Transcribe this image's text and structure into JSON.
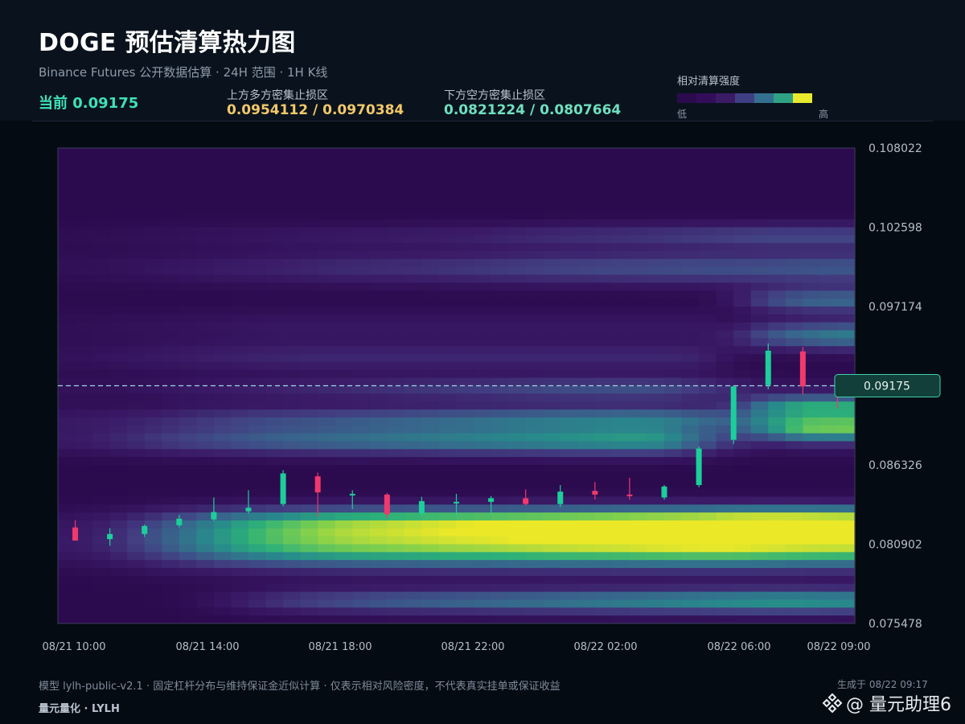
{
  "header": {
    "title": "DOGE 预估清算热力图",
    "subtitle": "Binance Futures 公开数据估算 · 24H 范围 · 1H K线",
    "current": "当前 0.09175",
    "upper_label": "上方多方密集止损区",
    "upper_value": "0.0954112 / 0.0970384",
    "lower_label": "下方空方密集止损区",
    "lower_value": "0.0821224 / 0.0807664"
  },
  "legend": {
    "title": "相对清算强度",
    "low": "低",
    "high": "高",
    "colors": [
      "#2c0a4e",
      "#330d5a",
      "#3b1a66",
      "#3e3f82",
      "#346f90",
      "#2ea383",
      "#e9e92d"
    ]
  },
  "colors": {
    "background": "#050b12",
    "header_bg": "#0a131d",
    "accent": "#3fe0b8",
    "upper_zone": "#f2c86a",
    "lower_zone": "#6fe0c0",
    "candle_up": "#1ccf9a",
    "candle_down": "#f0396d",
    "current_line": "#9fd6e3"
  },
  "chart_data": {
    "type": "heatmap",
    "overlay": "candlestick",
    "y_ticks": [
      "0.108022",
      "0.102598",
      "0.097174",
      "0.091750",
      "0.086326",
      "0.080902",
      "0.075478"
    ],
    "ylim": [
      0.075478,
      0.108022
    ],
    "x_ticks": [
      "08/21 10:00",
      "08/21 14:00",
      "08/21 18:00",
      "08/21 22:00",
      "08/22 02:00",
      "08/22 06:00",
      "08/22 09:00"
    ],
    "current_price": 0.09175,
    "current_price_label": "0.09175",
    "candles": [
      {
        "o": 0.08205,
        "h": 0.08255,
        "l": 0.08115,
        "c": 0.08115
      },
      {
        "o": 0.08125,
        "h": 0.082,
        "l": 0.0808,
        "c": 0.0816
      },
      {
        "o": 0.0816,
        "h": 0.08225,
        "l": 0.0814,
        "c": 0.08215
      },
      {
        "o": 0.0822,
        "h": 0.0829,
        "l": 0.08205,
        "c": 0.08265
      },
      {
        "o": 0.0826,
        "h": 0.0841,
        "l": 0.0825,
        "c": 0.0831
      },
      {
        "o": 0.08315,
        "h": 0.0846,
        "l": 0.083,
        "c": 0.0834
      },
      {
        "o": 0.08365,
        "h": 0.08597,
        "l": 0.0835,
        "c": 0.08575
      },
      {
        "o": 0.08555,
        "h": 0.0858,
        "l": 0.0828,
        "c": 0.08445
      },
      {
        "o": 0.0843,
        "h": 0.0846,
        "l": 0.0833,
        "c": 0.08435
      },
      {
        "o": 0.0843,
        "h": 0.0844,
        "l": 0.0827,
        "c": 0.08295
      },
      {
        "o": 0.083,
        "h": 0.08415,
        "l": 0.0828,
        "c": 0.08385
      },
      {
        "o": 0.0838,
        "h": 0.08435,
        "l": 0.08285,
        "c": 0.0838
      },
      {
        "o": 0.0838,
        "h": 0.0842,
        "l": 0.083,
        "c": 0.08405
      },
      {
        "o": 0.08405,
        "h": 0.08465,
        "l": 0.08355,
        "c": 0.08365
      },
      {
        "o": 0.08365,
        "h": 0.08495,
        "l": 0.08345,
        "c": 0.0845
      },
      {
        "o": 0.08455,
        "h": 0.08515,
        "l": 0.08395,
        "c": 0.0843
      },
      {
        "o": 0.0843,
        "h": 0.08545,
        "l": 0.08395,
        "c": 0.0842
      },
      {
        "o": 0.0841,
        "h": 0.08495,
        "l": 0.08395,
        "c": 0.08485
      },
      {
        "o": 0.08495,
        "h": 0.0876,
        "l": 0.0848,
        "c": 0.08745
      },
      {
        "o": 0.08805,
        "h": 0.09175,
        "l": 0.08775,
        "c": 0.0917
      },
      {
        "o": 0.0918,
        "h": 0.09465,
        "l": 0.0915,
        "c": 0.09415
      },
      {
        "o": 0.0941,
        "h": 0.0944,
        "l": 0.09115,
        "c": 0.0917
      },
      {
        "o": 0.09175,
        "h": 0.09195,
        "l": 0.0902,
        "c": 0.0916
      }
    ],
    "heat_bands": [
      {
        "center": 0.0809,
        "sigma": 0.0011,
        "intensity": [
          0.12,
          0.18,
          0.3,
          0.42,
          0.55,
          0.66,
          0.74,
          0.8,
          0.84,
          0.86,
          0.88,
          0.9,
          0.91,
          0.93,
          0.95,
          0.96,
          0.97,
          0.99,
          1.0,
          1.0,
          0.98,
          0.96,
          0.95
        ]
      },
      {
        "center": 0.0825,
        "sigma": 0.0007,
        "intensity": [
          0.05,
          0.08,
          0.14,
          0.22,
          0.3,
          0.38,
          0.44,
          0.5,
          0.54,
          0.56,
          0.58,
          0.6,
          0.62,
          0.64,
          0.66,
          0.68,
          0.7,
          0.72,
          0.74,
          0.78,
          0.8,
          0.8,
          0.78
        ]
      },
      {
        "center": 0.077,
        "sigma": 0.0006,
        "intensity": [
          0.0,
          0.0,
          0.0,
          0.02,
          0.08,
          0.16,
          0.24,
          0.3,
          0.34,
          0.38,
          0.4,
          0.42,
          0.44,
          0.46,
          0.48,
          0.5,
          0.52,
          0.54,
          0.56,
          0.58,
          0.6,
          0.6,
          0.58
        ]
      },
      {
        "center": 0.088,
        "sigma": 0.0007,
        "intensity": [
          0.12,
          0.16,
          0.22,
          0.28,
          0.32,
          0.36,
          0.4,
          0.42,
          0.44,
          0.46,
          0.48,
          0.5,
          0.52,
          0.54,
          0.56,
          0.58,
          0.6,
          0.58,
          0.4,
          0.2,
          0.1,
          0.1,
          0.1
        ]
      },
      {
        "center": 0.0895,
        "sigma": 0.0006,
        "intensity": [
          0.1,
          0.12,
          0.14,
          0.18,
          0.22,
          0.26,
          0.28,
          0.3,
          0.32,
          0.34,
          0.36,
          0.38,
          0.4,
          0.42,
          0.44,
          0.45,
          0.46,
          0.45,
          0.4,
          0.3,
          0.3,
          0.3,
          0.3
        ]
      },
      {
        "center": 0.0915,
        "sigma": 0.0006,
        "intensity": [
          0.06,
          0.06,
          0.08,
          0.1,
          0.12,
          0.14,
          0.16,
          0.18,
          0.2,
          0.22,
          0.24,
          0.26,
          0.28,
          0.3,
          0.32,
          0.33,
          0.34,
          0.32,
          0.26,
          0.18,
          0.1,
          0.08,
          0.08
        ]
      },
      {
        "center": 0.0888,
        "sigma": 0.0006,
        "intensity": [
          0.0,
          0.0,
          0.0,
          0.0,
          0.0,
          0.0,
          0.0,
          0.0,
          0.0,
          0.0,
          0.0,
          0.0,
          0.0,
          0.0,
          0.0,
          0.0,
          0.0,
          0.0,
          0.0,
          0.1,
          0.35,
          0.6,
          0.62
        ]
      },
      {
        "center": 0.0904,
        "sigma": 0.0005,
        "intensity": [
          0.0,
          0.0,
          0.0,
          0.0,
          0.0,
          0.0,
          0.0,
          0.0,
          0.0,
          0.0,
          0.0,
          0.0,
          0.0,
          0.0,
          0.0,
          0.0,
          0.0,
          0.0,
          0.0,
          0.1,
          0.4,
          0.55,
          0.55
        ]
      },
      {
        "center": 0.0952,
        "sigma": 0.0007,
        "intensity": [
          0.0,
          0.0,
          0.0,
          0.0,
          0.0,
          0.0,
          0.0,
          0.0,
          0.0,
          0.0,
          0.0,
          0.0,
          0.0,
          0.0,
          0.0,
          0.0,
          0.0,
          0.0,
          0.0,
          0.15,
          0.35,
          0.45,
          0.5
        ]
      },
      {
        "center": 0.0976,
        "sigma": 0.0006,
        "intensity": [
          0.0,
          0.0,
          0.0,
          0.0,
          0.0,
          0.0,
          0.0,
          0.0,
          0.0,
          0.0,
          0.0,
          0.0,
          0.0,
          0.0,
          0.0,
          0.0,
          0.0,
          0.0,
          0.0,
          0.1,
          0.3,
          0.4,
          0.42
        ]
      },
      {
        "center": 0.0998,
        "sigma": 0.0008,
        "intensity": [
          0.05,
          0.06,
          0.08,
          0.1,
          0.12,
          0.14,
          0.16,
          0.18,
          0.2,
          0.21,
          0.22,
          0.24,
          0.26,
          0.28,
          0.3,
          0.31,
          0.32,
          0.33,
          0.34,
          0.34,
          0.35,
          0.36,
          0.37
        ]
      },
      {
        "center": 0.102,
        "sigma": 0.0006,
        "intensity": [
          0.03,
          0.04,
          0.05,
          0.06,
          0.07,
          0.08,
          0.09,
          0.1,
          0.11,
          0.12,
          0.13,
          0.14,
          0.16,
          0.18,
          0.2,
          0.21,
          0.22,
          0.24,
          0.26,
          0.28,
          0.3,
          0.3,
          0.3
        ]
      },
      {
        "center": 0.0958,
        "sigma": 0.0008,
        "intensity": [
          0.04,
          0.05,
          0.06,
          0.07,
          0.08,
          0.09,
          0.1,
          0.1,
          0.1,
          0.1,
          0.1,
          0.1,
          0.1,
          0.1,
          0.1,
          0.1,
          0.1,
          0.1,
          0.1,
          0.0,
          0.0,
          0.0,
          0.0
        ]
      },
      {
        "center": 0.0937,
        "sigma": 0.0007,
        "intensity": [
          0.06,
          0.08,
          0.1,
          0.12,
          0.14,
          0.16,
          0.17,
          0.18,
          0.18,
          0.18,
          0.18,
          0.18,
          0.18,
          0.18,
          0.18,
          0.18,
          0.18,
          0.18,
          0.16,
          0.05,
          0.0,
          0.0,
          0.0
        ]
      }
    ]
  },
  "footer": {
    "note": "模型 lylh-public-v2.1 · 固定杠杆分布与维持保证金近似计算 · 仅表示相对风险密度，不代表真实挂单或保证收益",
    "brand": "量元量化 · LYLH",
    "generated": "生成于 08/22 09:17",
    "watermark_text": "@ 量元助理6"
  }
}
